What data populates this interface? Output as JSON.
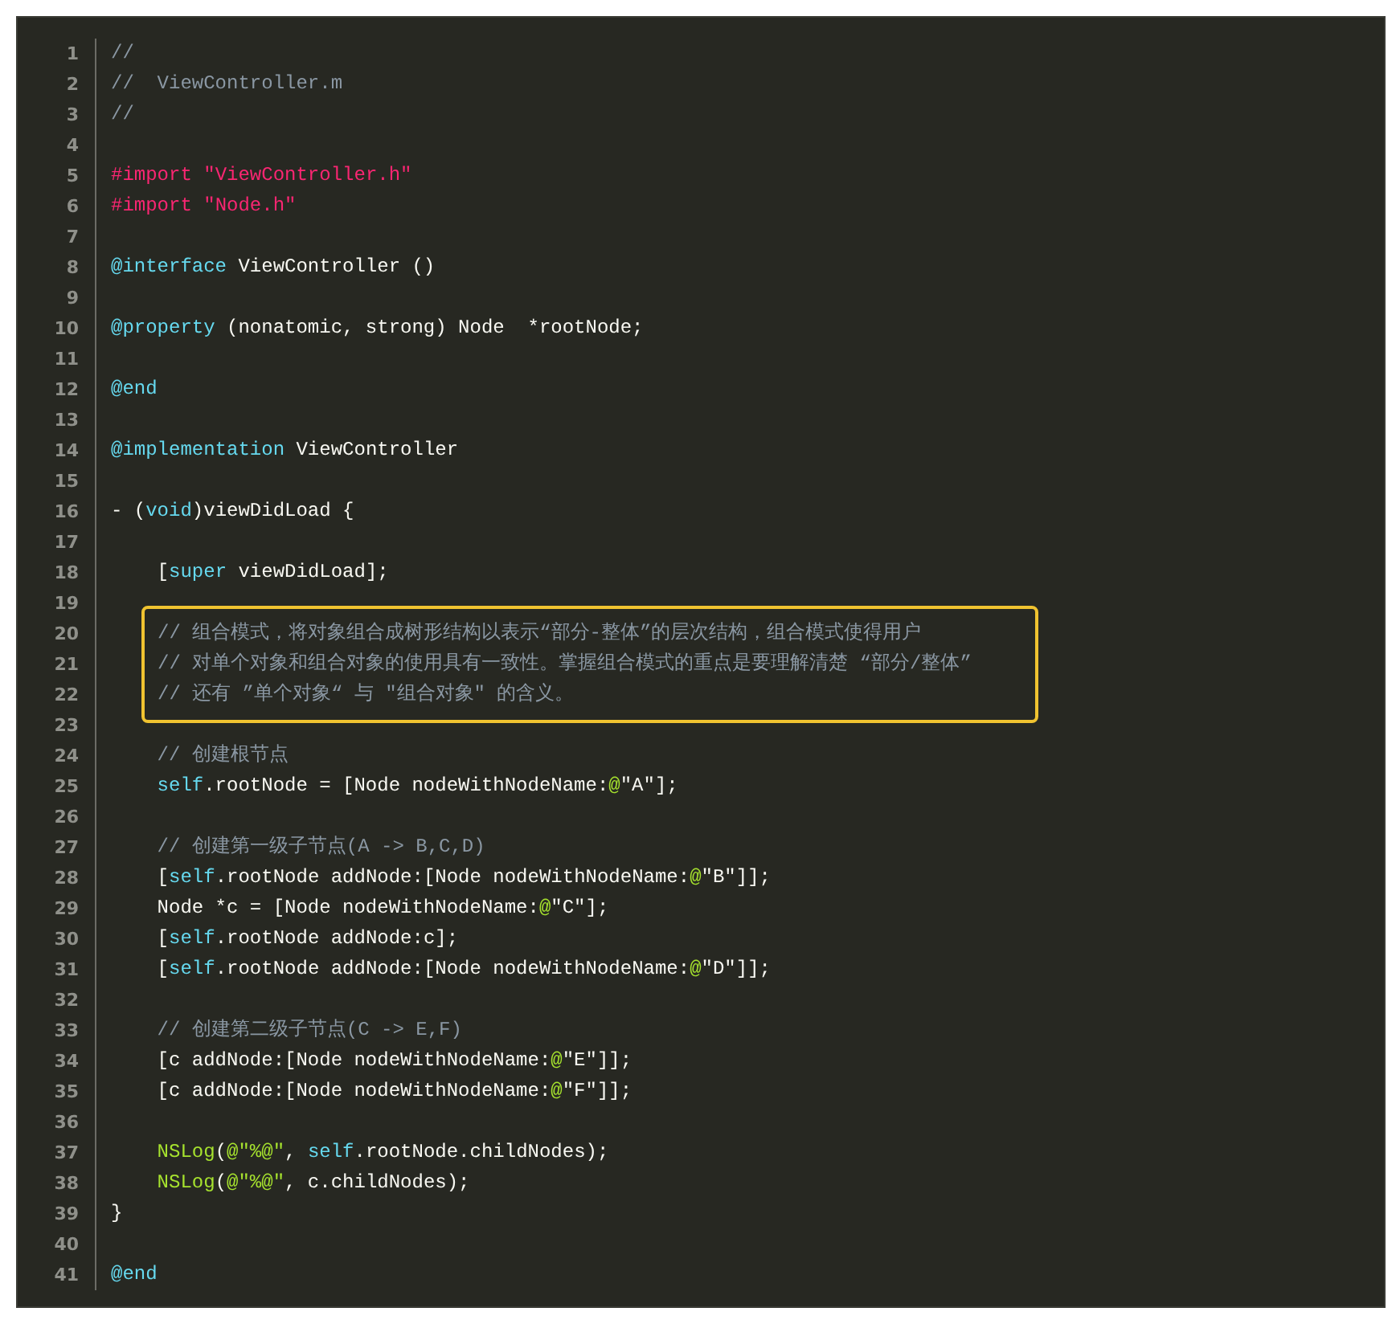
{
  "code_lines": [
    {
      "kind": "line",
      "number": "1",
      "tokens": [
        {
          "text": "//",
          "kind": "comment"
        }
      ]
    },
    {
      "kind": "line",
      "number": "2",
      "tokens": [
        {
          "text": "//  ViewController.m",
          "kind": "comment"
        }
      ]
    },
    {
      "kind": "line",
      "number": "3",
      "tokens": [
        {
          "text": "//",
          "kind": "comment"
        }
      ]
    },
    {
      "kind": "line",
      "number": "4"
    },
    {
      "kind": "line",
      "number": "5",
      "tokens": [
        {
          "text": "#import",
          "kind": "preproc"
        },
        {
          "text": " \"ViewController.h\"",
          "kind": "include"
        }
      ]
    },
    {
      "kind": "line",
      "number": "6",
      "tokens": [
        {
          "text": "#import",
          "kind": "preproc"
        },
        {
          "text": " \"Node.h\"",
          "kind": "include"
        }
      ]
    },
    {
      "kind": "line",
      "number": "7"
    },
    {
      "kind": "line",
      "number": "8",
      "tokens": [
        {
          "text": "@interface",
          "kind": "keyword"
        },
        {
          "text": " ViewController ()",
          "kind": "plain"
        }
      ]
    },
    {
      "kind": "line",
      "number": "9"
    },
    {
      "kind": "line",
      "number": "10",
      "tokens": [
        {
          "text": "@property",
          "kind": "keyword"
        },
        {
          "text": " (nonatomic, strong) Node  *rootNode;",
          "kind": "plain"
        }
      ]
    },
    {
      "kind": "line",
      "number": "11"
    },
    {
      "kind": "line",
      "number": "12",
      "tokens": [
        {
          "text": "@end",
          "kind": "keyword"
        }
      ]
    },
    {
      "kind": "line",
      "number": "13"
    },
    {
      "kind": "line",
      "number": "14",
      "tokens": [
        {
          "text": "@implementation",
          "kind": "keyword"
        },
        {
          "text": " ViewController",
          "kind": "plain"
        }
      ]
    },
    {
      "kind": "line",
      "number": "15"
    },
    {
      "kind": "line",
      "number": "16",
      "tokens": [
        {
          "text": "- (",
          "kind": "plain"
        },
        {
          "text": "void",
          "kind": "keyword"
        },
        {
          "text": ")viewDidLoad {",
          "kind": "plain"
        }
      ]
    },
    {
      "kind": "line",
      "number": "17"
    },
    {
      "kind": "line",
      "number": "18",
      "tokens": [
        {
          "text": "    [",
          "kind": "plain"
        },
        {
          "text": "super",
          "kind": "keyword"
        },
        {
          "text": " viewDidLoad];",
          "kind": "plain"
        }
      ]
    },
    {
      "kind": "line",
      "number": "19"
    },
    {
      "kind": "highlight",
      "lines": [
        {
          "kind": "line",
          "number": "20",
          "tokens": [
            {
              "text": "// 组合模式，将对象组合成树形结构以表示“部分-整体”的层次结构，组合模式使得用户",
              "kind": "comment"
            }
          ]
        },
        {
          "kind": "line",
          "number": "21",
          "tokens": [
            {
              "text": "// 对单个对象和组合对象的使用具有一致性。掌握组合模式的重点是要理解清楚 “部分/整体”",
              "kind": "comment"
            }
          ]
        },
        {
          "kind": "line",
          "number": "22",
          "tokens": [
            {
              "text": "// 还有 ”单个对象“ 与 \"组合对象\" 的含义。",
              "kind": "comment"
            }
          ]
        }
      ]
    },
    {
      "kind": "line",
      "number": "23"
    },
    {
      "kind": "line",
      "number": "24",
      "tokens": [
        {
          "text": "    // 创建根节点",
          "kind": "comment"
        }
      ]
    },
    {
      "kind": "line",
      "number": "25",
      "tokens": [
        {
          "text": "    self",
          "kind": "keyword"
        },
        {
          "text": ".rootNode = [Node nodeWithNodeName:",
          "kind": "plain"
        },
        {
          "text": "@",
          "kind": "literal"
        },
        {
          "text": "\"A\"];",
          "kind": "plain"
        }
      ]
    },
    {
      "kind": "line",
      "number": "26"
    },
    {
      "kind": "line",
      "number": "27",
      "tokens": [
        {
          "text": "    // 创建第一级子节点(A -> B,C,D)",
          "kind": "comment"
        }
      ]
    },
    {
      "kind": "line",
      "number": "28",
      "tokens": [
        {
          "text": "    [",
          "kind": "plain"
        },
        {
          "text": "self",
          "kind": "keyword"
        },
        {
          "text": ".rootNode addNode:[Node nodeWithNodeName:",
          "kind": "plain"
        },
        {
          "text": "@",
          "kind": "literal"
        },
        {
          "text": "\"B\"]];",
          "kind": "plain"
        }
      ]
    },
    {
      "kind": "line",
      "number": "29",
      "tokens": [
        {
          "text": "    Node *c = [Node nodeWithNodeName:",
          "kind": "plain"
        },
        {
          "text": "@",
          "kind": "literal"
        },
        {
          "text": "\"C\"];",
          "kind": "plain"
        }
      ]
    },
    {
      "kind": "line",
      "number": "30",
      "tokens": [
        {
          "text": "    [",
          "kind": "plain"
        },
        {
          "text": "self",
          "kind": "keyword"
        },
        {
          "text": ".rootNode addNode:c];",
          "kind": "plain"
        }
      ]
    },
    {
      "kind": "line",
      "number": "31",
      "tokens": [
        {
          "text": "    [",
          "kind": "plain"
        },
        {
          "text": "self",
          "kind": "keyword"
        },
        {
          "text": ".rootNode addNode:[Node nodeWithNodeName:",
          "kind": "plain"
        },
        {
          "text": "@",
          "kind": "literal"
        },
        {
          "text": "\"D\"]];",
          "kind": "plain"
        }
      ]
    },
    {
      "kind": "line",
      "number": "32"
    },
    {
      "kind": "line",
      "number": "33",
      "tokens": [
        {
          "text": "    // 创建第二级子节点(C -> E,F)",
          "kind": "comment"
        }
      ]
    },
    {
      "kind": "line",
      "number": "34",
      "tokens": [
        {
          "text": "    [c addNode:[Node nodeWithNodeName:",
          "kind": "plain"
        },
        {
          "text": "@",
          "kind": "literal"
        },
        {
          "text": "\"E\"]];",
          "kind": "plain"
        }
      ]
    },
    {
      "kind": "line",
      "number": "35",
      "tokens": [
        {
          "text": "    [c addNode:[Node nodeWithNodeName:",
          "kind": "plain"
        },
        {
          "text": "@",
          "kind": "literal"
        },
        {
          "text": "\"F\"]];",
          "kind": "plain"
        }
      ]
    },
    {
      "kind": "line",
      "number": "36"
    },
    {
      "kind": "line",
      "number": "37",
      "tokens": [
        {
          "text": "    NSLog",
          "kind": "function"
        },
        {
          "text": "(",
          "kind": "plain"
        },
        {
          "text": "@\"%@\"",
          "kind": "literal"
        },
        {
          "text": ", ",
          "kind": "plain"
        },
        {
          "text": "self",
          "kind": "keyword"
        },
        {
          "text": ".rootNode.childNodes);",
          "kind": "plain"
        }
      ]
    },
    {
      "kind": "line",
      "number": "38",
      "tokens": [
        {
          "text": "    NSLog",
          "kind": "function"
        },
        {
          "text": "(",
          "kind": "plain"
        },
        {
          "text": "@\"%@\"",
          "kind": "literal"
        },
        {
          "text": ", c.childNodes);",
          "kind": "plain"
        }
      ]
    },
    {
      "kind": "line",
      "number": "39",
      "tokens": [
        {
          "text": "}",
          "kind": "plain"
        }
      ]
    },
    {
      "kind": "line",
      "number": "40"
    },
    {
      "kind": "line",
      "number": "41",
      "tokens": [
        {
          "text": "@end",
          "kind": "keyword"
        }
      ]
    }
  ]
}
